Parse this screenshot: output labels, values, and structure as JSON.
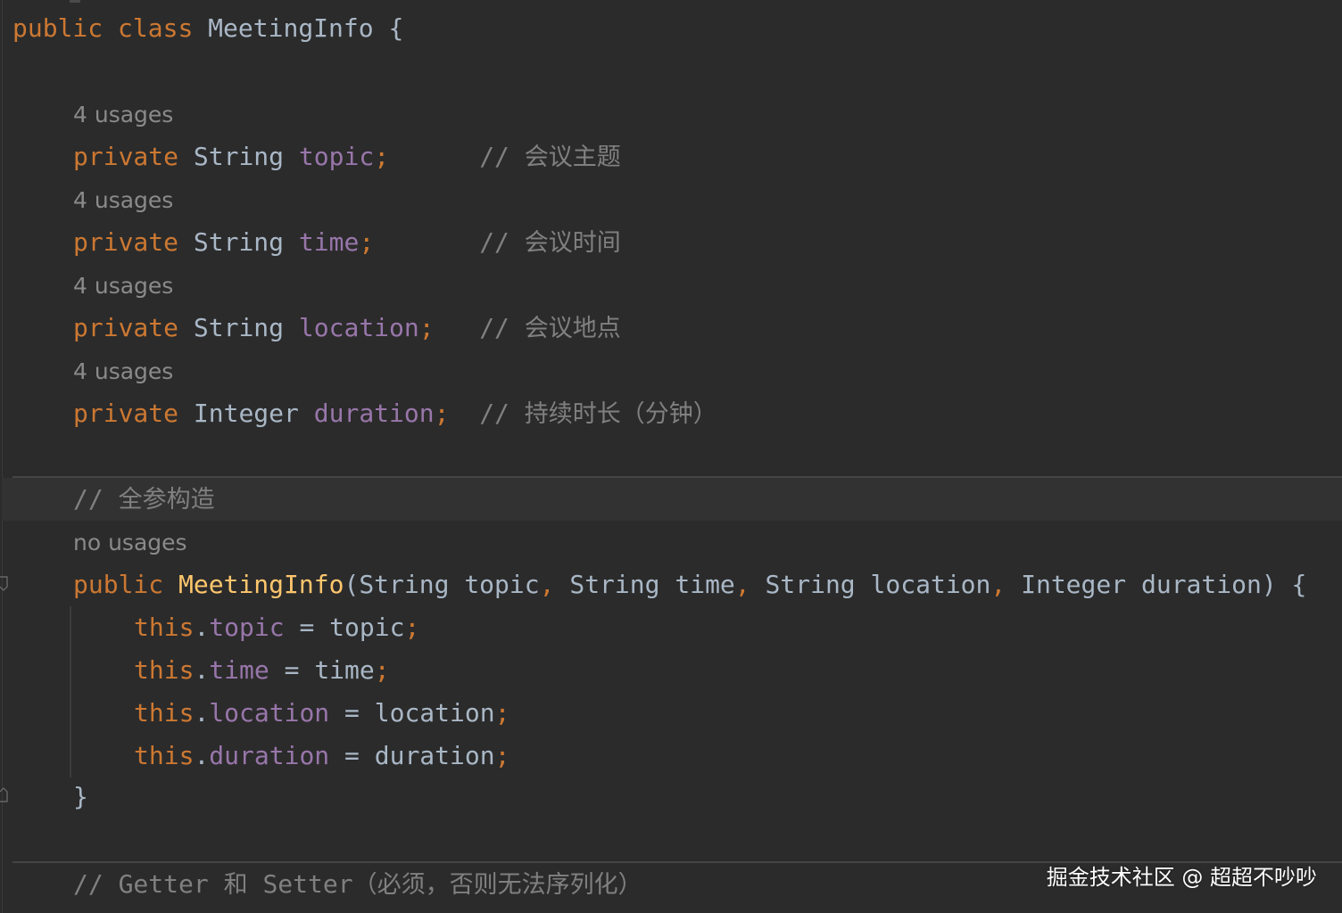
{
  "editor": {
    "class_decl": {
      "kw_public": "public",
      "kw_class": "class",
      "name": "MeetingInfo",
      "brace": "{"
    },
    "fields": [
      {
        "hint": "4 usages",
        "kw": "private",
        "type": "String",
        "name": "topic",
        "semi": ";",
        "pad": "      ",
        "comment_slashes": "//",
        "comment": "会议主题"
      },
      {
        "hint": "4 usages",
        "kw": "private",
        "type": "String",
        "name": "time",
        "semi": ";",
        "pad": "       ",
        "comment_slashes": "//",
        "comment": "会议时间"
      },
      {
        "hint": "4 usages",
        "kw": "private",
        "type": "String",
        "name": "location",
        "semi": ";",
        "pad": "   ",
        "comment_slashes": "//",
        "comment": "会议地点"
      },
      {
        "hint": "4 usages",
        "kw": "private",
        "type": "Integer",
        "name": "duration",
        "semi": ";",
        "pad": "  ",
        "comment_slashes": "//",
        "comment": "持续时长（分钟）"
      }
    ],
    "ctor_comment": {
      "slashes": "//",
      "text": "全参构造"
    },
    "ctor_hint": "no usages",
    "ctor": {
      "kw_public": "public",
      "name": "MeetingInfo",
      "open_paren": "(",
      "params": [
        {
          "type": "String",
          "name": "topic"
        },
        {
          "type": "String",
          "name": "time"
        },
        {
          "type": "String",
          "name": "location"
        },
        {
          "type": "Integer",
          "name": "duration"
        }
      ],
      "comma": ",",
      "close": ") {"
    },
    "assignments": [
      {
        "this": "this",
        "dot": ".",
        "field": "topic",
        "eq": " = ",
        "value": "topic",
        "semi": ";"
      },
      {
        "this": "this",
        "dot": ".",
        "field": "time",
        "eq": " = ",
        "value": "time",
        "semi": ";"
      },
      {
        "this": "this",
        "dot": ".",
        "field": "location",
        "eq": " = ",
        "value": "location",
        "semi": ";"
      },
      {
        "this": "this",
        "dot": ".",
        "field": "duration",
        "eq": " = ",
        "value": "duration",
        "semi": ";"
      }
    ],
    "ctor_close": "}",
    "getter_comment": {
      "slashes": "//",
      "text_a": "Getter",
      "text_he": "和",
      "text_b": "Setter",
      "text_c": "（必须，否则无法序列化）"
    }
  },
  "watermark": "掘金技术社区 @ 超超不吵吵",
  "colors": {
    "background": "#2b2b2b",
    "keyword": "#cc7832",
    "field": "#9876aa",
    "method": "#ffc66d",
    "text": "#a9b7c6",
    "comment": "#808080",
    "hint": "#8a8a8a"
  }
}
